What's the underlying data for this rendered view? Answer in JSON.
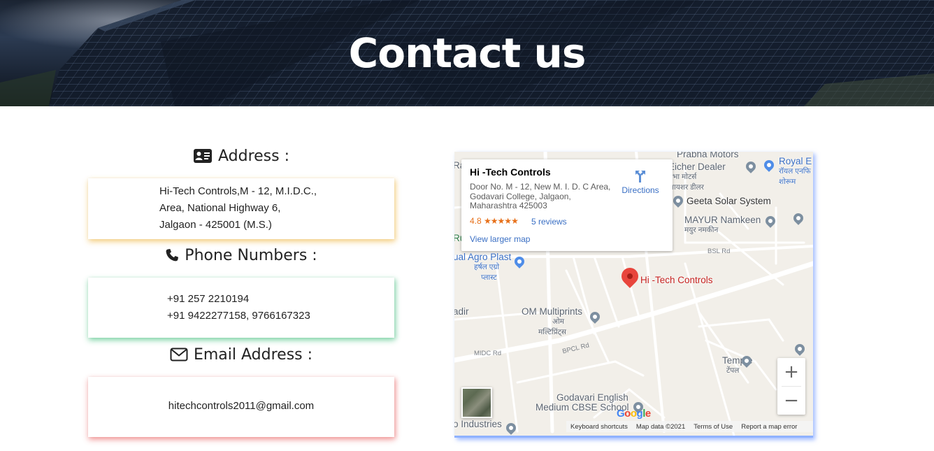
{
  "hero": {
    "title": "Contact us"
  },
  "address": {
    "heading": "Address :",
    "icon": "address-card-icon",
    "lines": [
      "Hi-Tech Controls,M - 12, M.I.D.C.,",
      "Area, National Highway 6,",
      "Jalgaon - 425001 (M.S.)"
    ]
  },
  "phone": {
    "heading": "Phone Numbers :",
    "icon": "phone-icon",
    "lines": [
      "+91 257 2210194",
      "+91 9422277158, 9766167323"
    ]
  },
  "email": {
    "heading": "Email Address :",
    "icon": "envelope-icon",
    "value": "hitechcontrols2011@gmail.com"
  },
  "colors": {
    "address_glow": "#f0b43c",
    "phone_glow": "#3cbe78",
    "email_glow": "#eb5a5a",
    "map_glow": "#5082ff"
  },
  "map": {
    "info": {
      "title": "Hi -Tech Controls",
      "address": "Door No. M - 12, New M. I. D. C Area, Godavari College, Jalgaon, Maharashtra 425003",
      "rating": "4.8",
      "stars": "★★★★★",
      "reviews": "5 reviews",
      "larger_map": "View larger map",
      "directions": "Directions"
    },
    "marker_label": "Hi -Tech Controls",
    "pois": {
      "prabha": "Prabha Motors",
      "eicher": "Eicher Dealer",
      "eicher_local": "प्रभा मोटर्स",
      "eicher_local2": "आयशर डीलर",
      "royal": "Royal E",
      "royal_local": "रॉयल एनफि",
      "royal_local2": "शोरूम",
      "geeta": "Geeta Solar System",
      "mayur": "MAYUR Namkeen",
      "mayur_local": "मयुर नमकीन",
      "agro": "ual Agro Plast",
      "agro_local": "हर्षल एग्रो",
      "agro_local2": "प्लास्ट",
      "om": "OM Multiprints",
      "om_local": "ओम",
      "om_local2": "मल्टिप्रिंट्स",
      "temple": "Temple",
      "temple_local": "टेंपल",
      "godavari": "Godavari English",
      "godavari2": "Medium CBSE School",
      "industries": "o Industries",
      "adir": "adir",
      "ra": "Ra",
      "ru": "Ru"
    },
    "roads": {
      "bsl": "BSL Rd",
      "bpcl": "BPCL Rd",
      "midc": "MIDC Rd"
    },
    "footer": {
      "shortcuts": "Keyboard shortcuts",
      "data": "Map data ©2021",
      "terms": "Terms of Use",
      "report": "Report a map error"
    },
    "google": "Google",
    "zoom_in": "+",
    "zoom_out": "−"
  }
}
